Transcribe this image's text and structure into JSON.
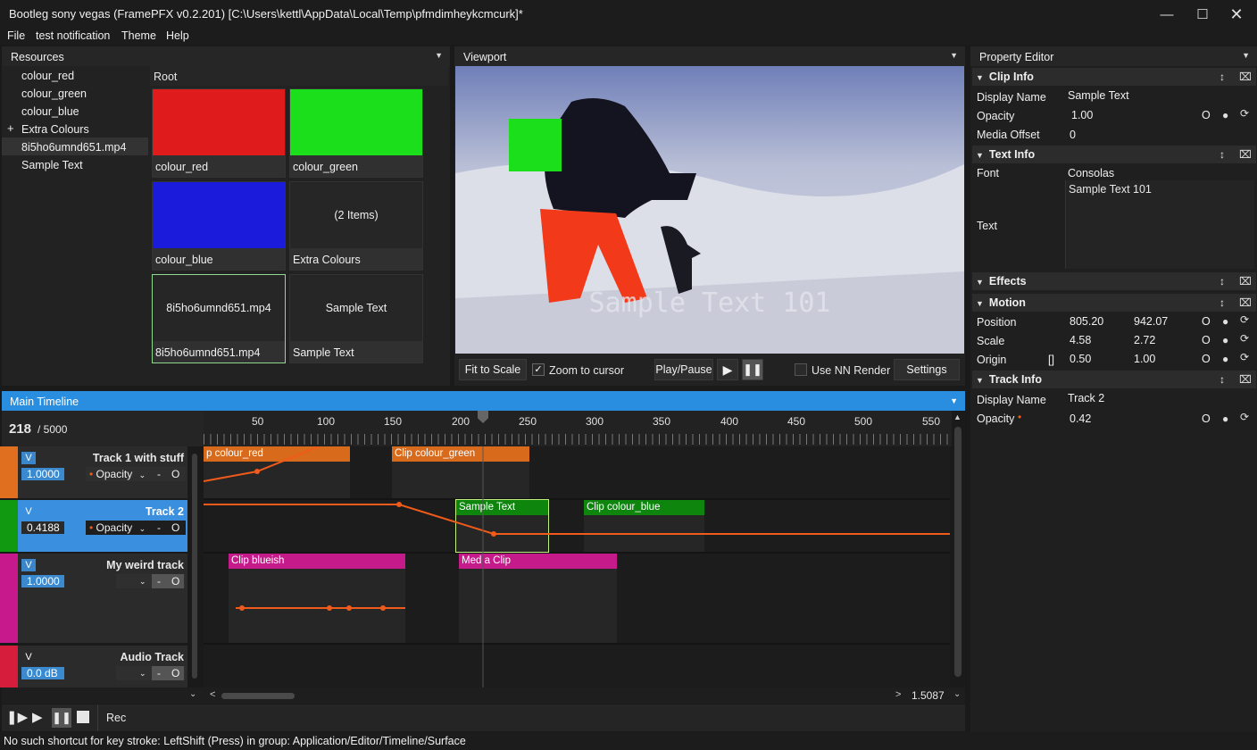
{
  "window": {
    "title": "Bootleg sony vegas (FramePFX v0.2.201) [C:\\Users\\kettl\\AppData\\Local\\Temp\\pfmdimheykcmcurk]*"
  },
  "menu": [
    "File",
    "test notification",
    "Theme",
    "Help"
  ],
  "resources": {
    "title": "Resources",
    "tree": [
      "colour_red",
      "colour_green",
      "colour_blue",
      "Extra Colours",
      "8i5ho6umnd651.mp4",
      "Sample Text"
    ],
    "tree_expander": "+",
    "folder": "Root",
    "tiles": [
      {
        "label": "colour_red",
        "color": "#e01b1b"
      },
      {
        "label": "colour_green",
        "color": "#1bdf1b"
      },
      {
        "label": "colour_blue",
        "color": "#1b1bdc"
      },
      {
        "label": "Extra Colours",
        "center": "(2 Items)"
      },
      {
        "label": "8i5ho6umnd651.mp4",
        "center": "8i5ho6umnd651.mp4"
      },
      {
        "label": "Sample Text",
        "center": "Sample Text"
      }
    ]
  },
  "viewport": {
    "title": "Viewport",
    "overlay_text": "Sample Text 101",
    "controls": {
      "fit": "Fit to Scale",
      "zoom": "Zoom to cursor",
      "play_pause": "Play/Pause",
      "nn": "Use NN Render",
      "settings": "Settings"
    }
  },
  "property_editor": {
    "title": "Property Editor",
    "clip_info": {
      "title": "Clip Info",
      "display_name_label": "Display Name",
      "display_name": "Sample Text",
      "opacity_label": "Opacity",
      "opacity": "1.00",
      "media_offset_label": "Media Offset",
      "media_offset": "0"
    },
    "text_info": {
      "title": "Text Info",
      "font_label": "Font",
      "font": "Consolas",
      "text_label": "Text",
      "text": "Sample Text 101"
    },
    "effects": {
      "title": "Effects"
    },
    "motion": {
      "title": "Motion",
      "position_label": "Position",
      "pos_x": "805.20",
      "pos_y": "942.07",
      "scale_label": "Scale",
      "scale_x": "4.58",
      "scale_y": "2.72",
      "origin_label": "Origin",
      "origin_icon": "[]",
      "origin_x": "0.50",
      "origin_y": "1.00"
    },
    "track_info": {
      "title": "Track Info",
      "display_name_label": "Display Name",
      "display_name": "Track 2",
      "opacity_label": "Opacity",
      "opacity": "0.42"
    },
    "reset_glyph": "O"
  },
  "timeline": {
    "title": "Main Timeline",
    "frame": "218",
    "total": "/ 5000",
    "ruler": [
      "50",
      "100",
      "150",
      "200",
      "250",
      "300",
      "350",
      "400",
      "450",
      "500",
      "550"
    ],
    "zoom": "1.5087",
    "record": "Rec",
    "tracks": [
      {
        "name": "Track 1 with stuff",
        "color": "#e07020",
        "value": "1.0000",
        "param": "Opacity",
        "v": "V",
        "minus": "-",
        "o": "O"
      },
      {
        "name": "Track 2",
        "color": "#119a11",
        "value": "0.4188",
        "param": "Opacity",
        "v": "V",
        "minus": "-",
        "o": "O"
      },
      {
        "name": "My weird track",
        "color": "#c8198c",
        "value": "1.0000",
        "param": "",
        "v": "V",
        "minus": "-",
        "o": "O"
      },
      {
        "name": "Audio Track",
        "color": "#d61e3c",
        "value": "0.0 dB",
        "param": "",
        "v": "V",
        "minus": "-",
        "o": "O"
      }
    ],
    "clips": [
      {
        "label": "p colour_red",
        "color": "#d86a1c"
      },
      {
        "label": "Clip colour_green",
        "color": "#d86a1c"
      },
      {
        "label": "Sample Text",
        "color": "#0e860e"
      },
      {
        "label": "Clip colour_blue",
        "color": "#0e860e"
      },
      {
        "label": "Clip blueish",
        "color": "#c51b8a"
      },
      {
        "label": "Med a Clip",
        "color": "#c51b8a"
      }
    ]
  },
  "status": "No such shortcut for key stroke: LeftShift (Press) in group: Application/Editor/Timeline/Surface"
}
